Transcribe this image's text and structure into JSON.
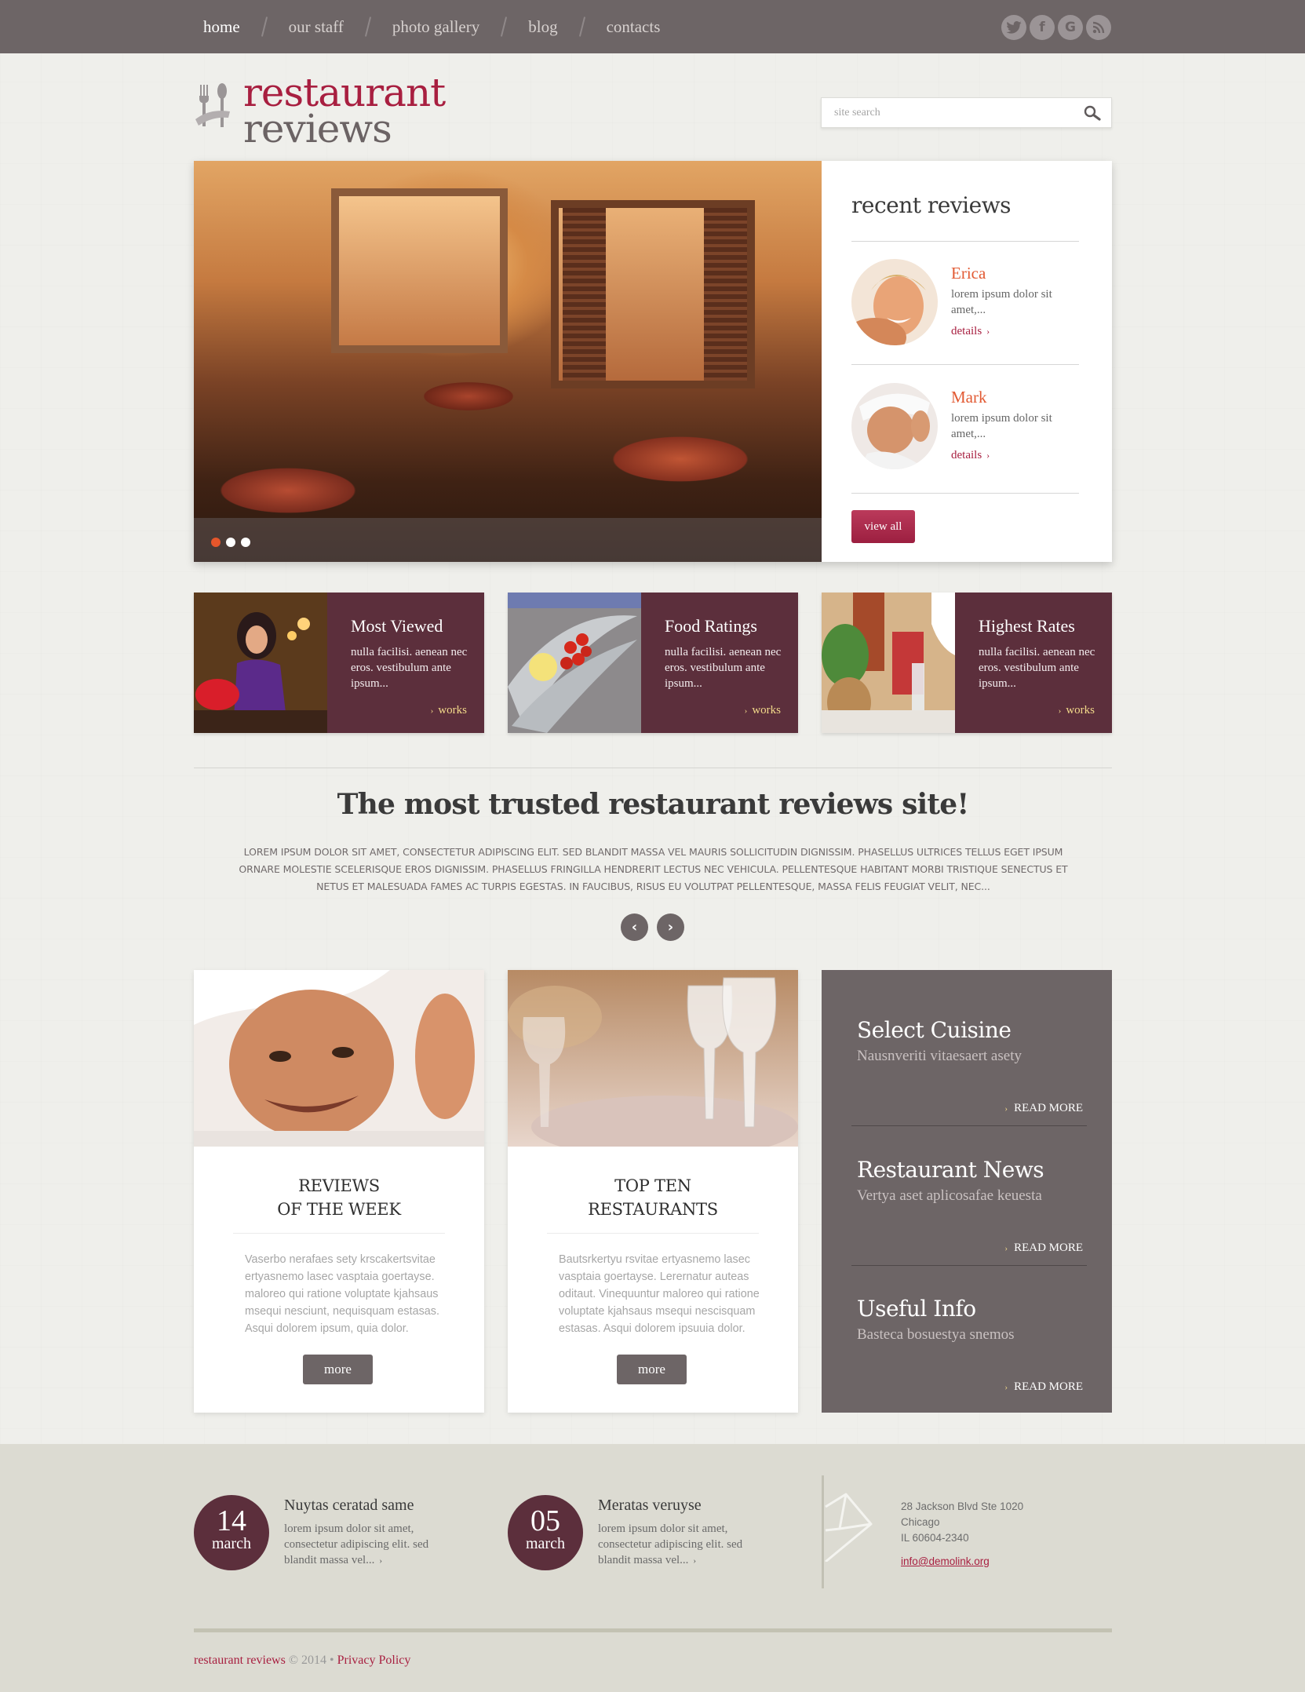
{
  "colors": {
    "accent_red": "#a81f40",
    "orange": "#e25a33",
    "plum": "#5c2f3c",
    "taupe": "#6d6566",
    "gold": "#f2d98a"
  },
  "nav": {
    "items": [
      {
        "label": "home",
        "active": true
      },
      {
        "label": "our staff"
      },
      {
        "label": "photo gallery"
      },
      {
        "label": "blog"
      },
      {
        "label": "contacts"
      }
    ],
    "social": [
      {
        "icon": "twitter-icon",
        "glyph": "t"
      },
      {
        "icon": "facebook-icon",
        "glyph": "f"
      },
      {
        "icon": "google-icon",
        "glyph": "G"
      },
      {
        "icon": "rss-icon",
        "glyph": "◉"
      }
    ]
  },
  "header": {
    "logo_line1": "restaurant",
    "logo_line2": "reviews",
    "search_placeholder": "site search"
  },
  "slider": {
    "slide_count": 3,
    "active_slide": 1
  },
  "recent_reviews": {
    "title": "recent reviews",
    "items": [
      {
        "name": "Erica",
        "text": "lorem ipsum dolor sit amet,...",
        "link": "details"
      },
      {
        "name": "Mark",
        "text": "lorem ipsum dolor sit amet,...",
        "link": "details"
      }
    ],
    "view_all": "view all"
  },
  "features": [
    {
      "title": "Most Viewed",
      "text": "nulla facilisi. aenean nec eros. vestibulum ante ipsum...",
      "link": "works"
    },
    {
      "title": "Food Ratings",
      "text": "nulla facilisi. aenean nec eros. vestibulum ante ipsum...",
      "link": "works"
    },
    {
      "title": "Highest Rates",
      "text": "nulla facilisi. aenean nec eros. vestibulum ante ipsum...",
      "link": "works"
    }
  ],
  "intro": {
    "title": "The most trusted restaurant reviews site!",
    "text": "Lorem ipsum dolor sit amet, consectetur adipiscing elit. Sed blandit massa vel mauris sollicitudin dignissim. Phasellus ultrices tellus eget ipsum ornare molestie scelerisque eros dignissim. Phasellus fringilla hendrerit lectus nec vehicula. Pellentesque habitant morbi tristique senectus et netus et malesuada fames ac turpis egestas. In faucibus, risus eu volutpat pellentesque, massa felis feugiat velit, nec...",
    "prev": "‹",
    "next": "›"
  },
  "cards": [
    {
      "title_line1": "REVIEWS",
      "title_line2": "OF THE WEEK",
      "text": "Vaserbo nerafaes sety krscakertsvitae ertyasnemo lasec vasptaia goertayse. maloreo qui ratione voluptate kjahsaus msequi nesciunt, nequisquam estasas. Asqui dolorem ipsum, quia dolor.",
      "button": "more"
    },
    {
      "title_line1": "TOP TEN",
      "title_line2": "RESTAURANTS",
      "text": "Bautsrkertyu rsvitae ertyasnemo lasec vasptaia goertayse. Lerernatur auteas oditaut. Vinequuntur maloreo qui ratione voluptate kjahsaus msequi nescisquam estasas. Asqui dolorem ipsuuia dolor.",
      "button": "more"
    }
  ],
  "info": [
    {
      "title": "Select Cuisine",
      "sub": "Nausnveriti vitaesaert asety",
      "link": "READ MORE"
    },
    {
      "title": "Restaurant News",
      "sub": "Vertya aset aplicosafae keuesta",
      "link": "READ MORE"
    },
    {
      "title": "Useful Info",
      "sub": "Basteca bosuestya snemos",
      "link": "READ MORE"
    }
  ],
  "footer": {
    "events": [
      {
        "day": "14",
        "month": "march",
        "title": "Nuytas ceratad same",
        "text": "lorem ipsum dolor sit amet, consectetur adipiscing elit. sed blandit massa vel..."
      },
      {
        "day": "05",
        "month": "march",
        "title": "Meratas veruyse",
        "text": "lorem ipsum dolor sit amet, consectetur adipiscing elit. sed blandit massa vel..."
      }
    ],
    "address": {
      "line1": "28 Jackson Blvd Ste 1020",
      "line2": "Chicago",
      "line3": "IL 60604-2340",
      "email": "info@demolink.org"
    },
    "copyright_brand": "restaurant reviews",
    "copyright_text": " © 2014 • ",
    "privacy": "Privacy Policy"
  }
}
